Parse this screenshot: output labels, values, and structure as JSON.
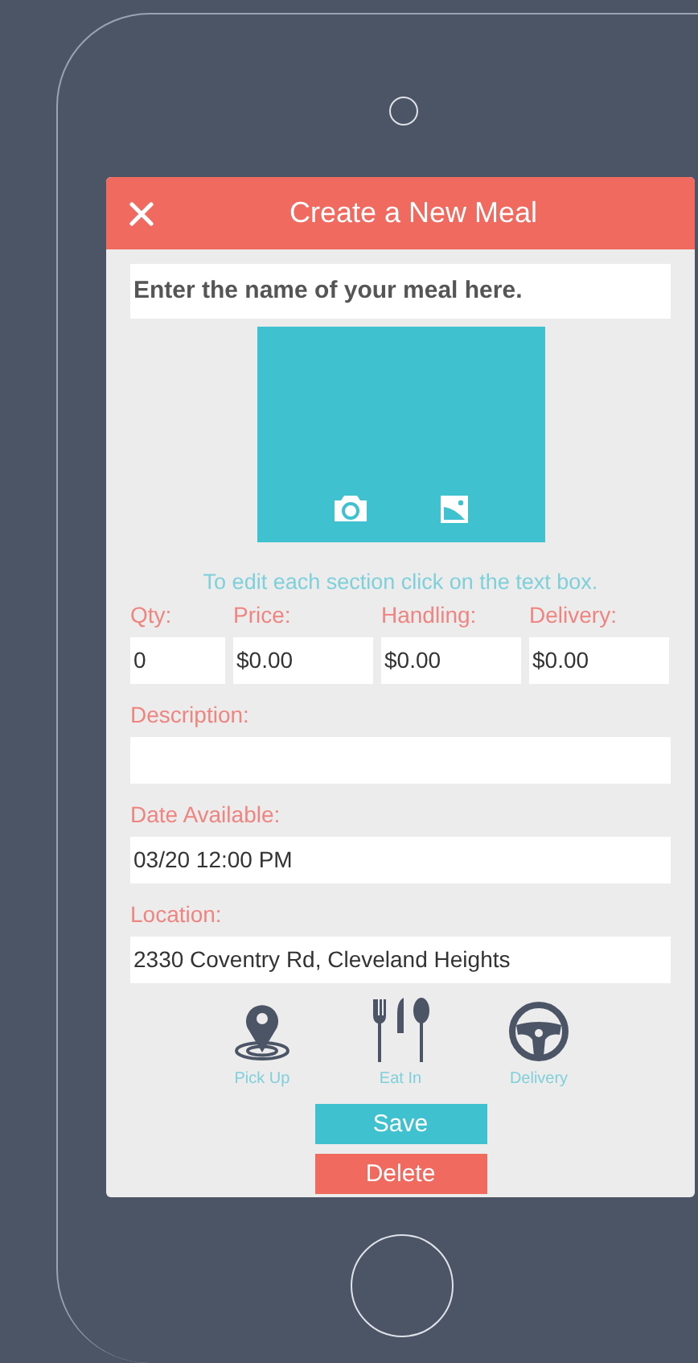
{
  "header": {
    "title": "Create a New Meal"
  },
  "meal_name": {
    "value": "Enter the name of your meal here."
  },
  "hint": "To edit each section click on the text box.",
  "cost_fields": [
    {
      "label": "Qty:",
      "value": "0"
    },
    {
      "label": "Price:",
      "value": "$0.00"
    },
    {
      "label": "Handling:",
      "value": "$0.00"
    },
    {
      "label": "Delivery:",
      "value": "$0.00"
    }
  ],
  "fields": [
    {
      "label": "Description:"
    },
    {
      "label": "Date Available:",
      "value": "03/20 12:00 PM"
    },
    {
      "label": "Location:",
      "value": "2330 Coventry Rd, Cleveland Heights"
    }
  ],
  "options": [
    {
      "kind": "pickup",
      "label": "Pick Up"
    },
    {
      "kind": "eatin",
      "label": "Eat In"
    },
    {
      "kind": "delivery",
      "label": "Delivery"
    }
  ],
  "buttons": [
    {
      "kind": "save",
      "label": "Save"
    },
    {
      "kind": "delete",
      "label": "Delete"
    }
  ]
}
